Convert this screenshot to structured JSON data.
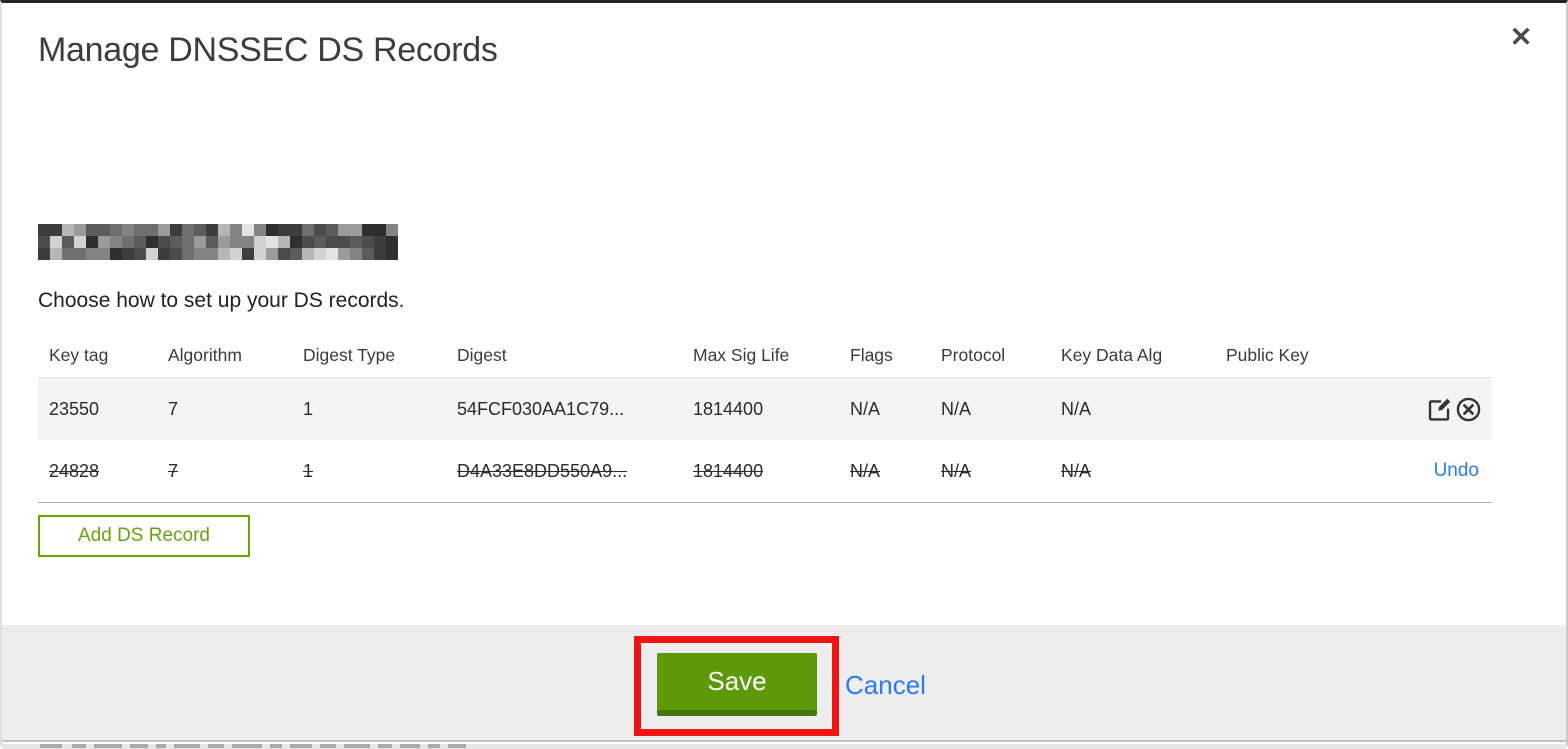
{
  "modal": {
    "title": "Manage DNSSEC DS Records",
    "subtitle": "Choose how to set up your DS records.",
    "close_glyph": "✕",
    "domain": {
      "redacted": true
    }
  },
  "table": {
    "headers": [
      "Key tag",
      "Algorithm",
      "Digest Type",
      "Digest",
      "Max Sig Life",
      "Flags",
      "Protocol",
      "Key Data Alg",
      "Public Key"
    ],
    "rows": [
      {
        "state": "active",
        "cells": [
          "23550",
          "7",
          "1",
          "54FCF030AA1C79...",
          "1814400",
          "N/A",
          "N/A",
          "N/A",
          ""
        ],
        "action_icons": [
          "edit-icon",
          "remove-circle-x-icon"
        ]
      },
      {
        "state": "deleted",
        "cells": [
          "24828",
          "7",
          "1",
          "D4A33E8DD550A9...",
          "1814400",
          "N/A",
          "N/A",
          "N/A",
          ""
        ],
        "undo_label": "Undo"
      }
    ]
  },
  "buttons": {
    "add_ds_record": "Add DS Record",
    "save": "Save",
    "cancel": "Cancel"
  },
  "colors": {
    "accent_green": "#6ca10e",
    "save_green": "#5d9908",
    "save_green_dark": "#47770a",
    "link_blue": "#2d7af0",
    "annotation_red": "#ee1515",
    "footer_gray": "#ededed",
    "row_gray": "#f4f4f4"
  }
}
